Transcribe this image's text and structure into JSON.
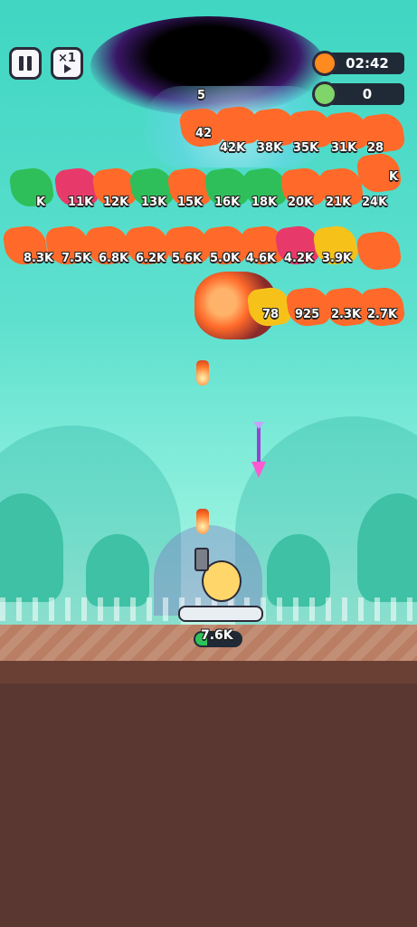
{
  "hud": {
    "speed_label": "×1",
    "timer": "02:42",
    "kills": "0"
  },
  "enemy_labels": {
    "row0": [
      "5"
    ],
    "row1": [
      "42",
      "42K",
      "38K",
      "35K",
      "31K",
      "28"
    ],
    "row2": [
      "K",
      "11K",
      "12K",
      "13K",
      "15K",
      "16K",
      "18K",
      "20K",
      "21K",
      "24K",
      "K"
    ],
    "row3": [
      "8.3K",
      "7.5K",
      "6.8K",
      "6.2K",
      "5.6K",
      "5.0K",
      "4.6K",
      "4.2K",
      "3.9K"
    ],
    "row4": [
      "78",
      "925",
      "2.3K",
      "2.7K"
    ]
  },
  "player": {
    "hp": "7.6K",
    "hp_fill": 0.25
  },
  "colors": {
    "enemy_orange": "#ff6a2a",
    "enemy_green": "#2fbf5a",
    "enemy_pink": "#e83a6a",
    "enemy_yellow": "#f6c21a",
    "vortex": "#3a1766",
    "hp_green": "#2fc25a"
  }
}
